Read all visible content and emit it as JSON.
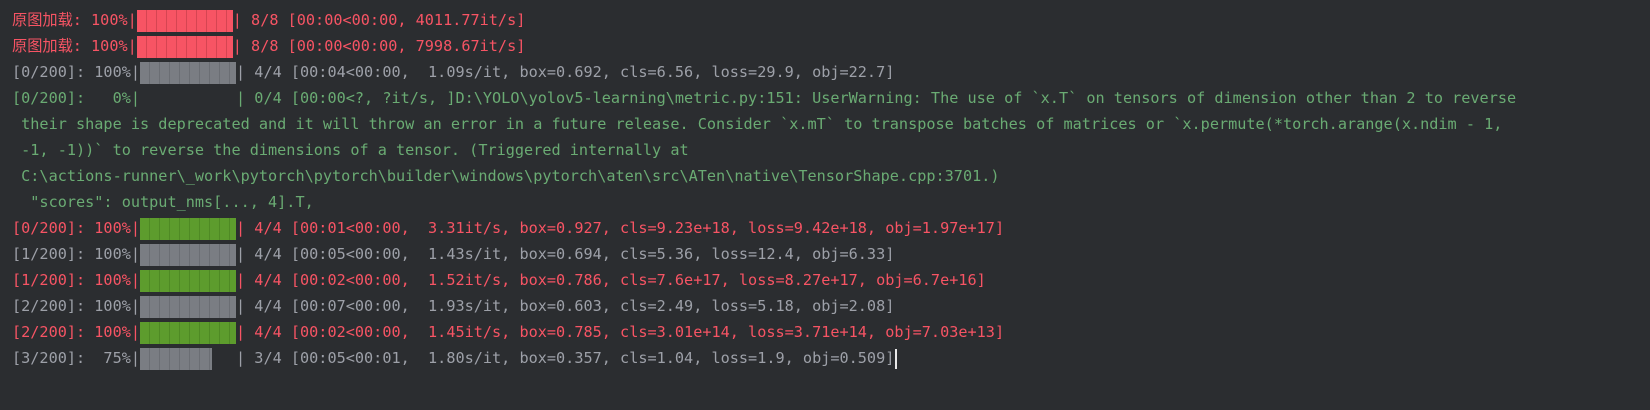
{
  "terminal": {
    "cut_line": "  ...　　　　　　　　　　　　　　",
    "lines": [
      {
        "prefix": "原图加载: 100%|",
        "suffix": "| 8/8 [00:00<00:00, 4011.77it/s]",
        "progress": 1.0,
        "style": "red"
      },
      {
        "prefix": "原图加载: 100%|",
        "suffix": "| 8/8 [00:00<00:00, 7998.67it/s]",
        "progress": 1.0,
        "style": "red"
      },
      {
        "prefix": "[0/200]: 100%|",
        "suffix": "| 4/4 [00:04<00:00,  1.09s/it, box=0.692, cls=6.56, loss=29.9, obj=22.7]",
        "progress": 1.0,
        "style": "gray"
      },
      {
        "prefix": "[0/200]:   0%|",
        "suffix": "| 0/4 [00:00<?, ?it/s, ]D:\\YOLO\\yolov5-learning\\metric.py:151: UserWarning: The use of `x.T` on tensors of dimension other than 2 to reverse",
        "progress": 0.0,
        "style": "warn"
      },
      {
        "text": " their shape is deprecated and it will throw an error in a future release. Consider `x.mT` to transpose batches of matrices or `x.permute(*torch.arange(x.ndim - 1,",
        "style": "warn"
      },
      {
        "text": " -1, -1))` to reverse the dimensions of a tensor. (Triggered internally at",
        "style": "warn"
      },
      {
        "text": " C:\\actions-runner\\_work\\pytorch\\pytorch\\builder\\windows\\pytorch\\aten\\src\\ATen\\native\\TensorShape.cpp:3701.)",
        "style": "warn"
      },
      {
        "text": "  \"scores\": output_nms[..., 4].T,",
        "style": "warn"
      },
      {
        "prefix": "[0/200]: 100%|",
        "suffix": "| 4/4 [00:01<00:00,  3.31it/s, box=0.927, cls=9.23e+18, loss=9.42e+18, obj=1.97e+17]",
        "progress": 1.0,
        "style": "red"
      },
      {
        "prefix": "[1/200]: 100%|",
        "suffix": "| 4/4 [00:05<00:00,  1.43s/it, box=0.694, cls=5.36, loss=12.4, obj=6.33]",
        "progress": 1.0,
        "style": "gray"
      },
      {
        "prefix": "[1/200]: 100%|",
        "suffix": "| 4/4 [00:02<00:00,  1.52it/s, box=0.786, cls=7.6e+17, loss=8.27e+17, obj=6.7e+16]",
        "progress": 1.0,
        "style": "red"
      },
      {
        "prefix": "[2/200]: 100%|",
        "suffix": "| 4/4 [00:07<00:00,  1.93s/it, box=0.603, cls=2.49, loss=5.18, obj=2.08]",
        "progress": 1.0,
        "style": "gray"
      },
      {
        "prefix": "[2/200]: 100%|",
        "suffix": "| 4/4 [00:02<00:00,  1.45it/s, box=0.785, cls=3.01e+14, loss=3.71e+14, obj=7.03e+13]",
        "progress": 1.0,
        "style": "red"
      },
      {
        "prefix": "[3/200]:  75%|",
        "suffix": "| 3/4 [00:05<00:01,  1.80s/it, box=0.357, cls=1.04, loss=1.9, obj=0.509]",
        "progress": 0.75,
        "style": "gray"
      }
    ],
    "colors": {
      "background": "#2b2d30",
      "red": "#f75464",
      "gray": "#9da0a8",
      "green_bar": "#5d9c2d",
      "warning": "#6aab73"
    }
  }
}
